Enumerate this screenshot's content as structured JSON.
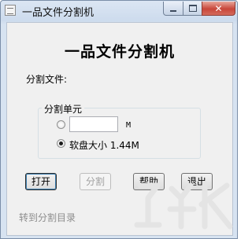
{
  "window": {
    "title": "一品文件分割机",
    "controls": {
      "minimize_icon": "minimize-icon",
      "maximize_icon": "maximize-icon",
      "close_glyph": "✕"
    }
  },
  "main": {
    "heading": "一品文件分割机",
    "file_label": "分割文件:",
    "group": {
      "title": "分割单元",
      "custom_size_value": "",
      "custom_unit": "M",
      "floppy_label": "软盘大小 1.44M",
      "selected": "floppy"
    },
    "buttons": {
      "open": "打开",
      "split": "分割",
      "help": "帮助",
      "exit": "退出"
    },
    "link": "转到分割目录"
  },
  "colors": {
    "title_bar": "#cddbed",
    "client_bg": "#f0f0f0",
    "close_button": "#c8463a",
    "disabled_text": "#a0a0a0",
    "link_text": "#8d8d8d"
  }
}
